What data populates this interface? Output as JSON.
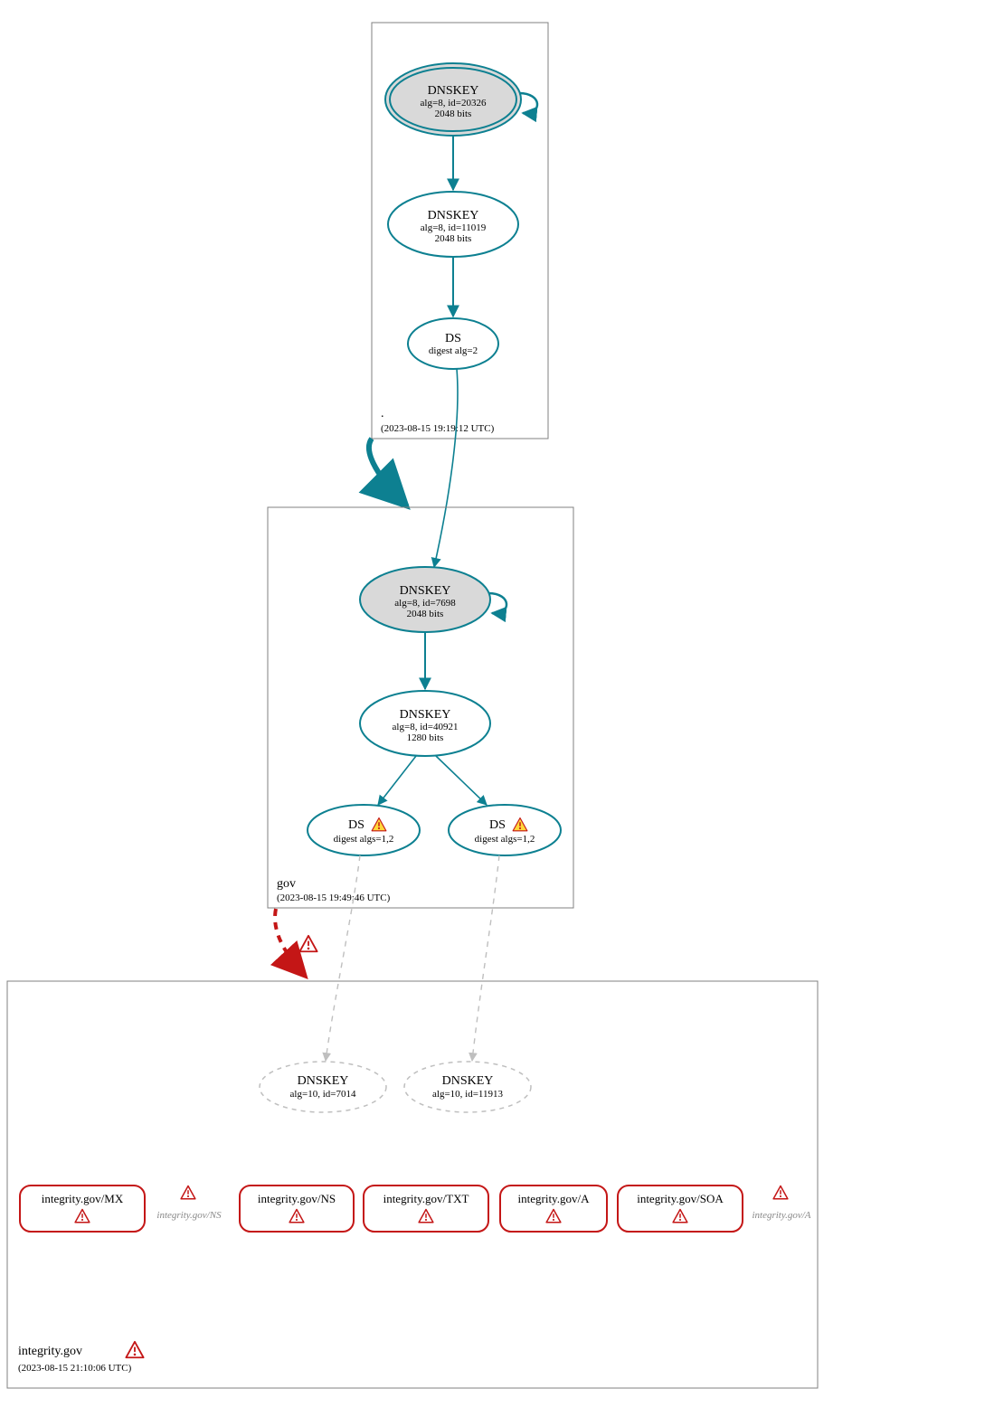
{
  "colors": {
    "teal": "#0d8091",
    "gray_fill": "#d9d9d9",
    "gray_dash": "#bfbfbf",
    "gray_text": "#888888",
    "box_stroke": "#808080",
    "red": "#c41616",
    "warn_fill": "#ffd83a",
    "warn_stroke": "#c41616"
  },
  "zones": {
    "root": {
      "name": ".",
      "timestamp": "(2023-08-15 19:19:12 UTC)",
      "ksk": {
        "title": "DNSKEY",
        "line1": "alg=8, id=20326",
        "line2": "2048 bits"
      },
      "zsk": {
        "title": "DNSKEY",
        "line1": "alg=8, id=11019",
        "line2": "2048 bits"
      },
      "ds": {
        "title": "DS",
        "line1": "digest alg=2"
      }
    },
    "gov": {
      "name": "gov",
      "timestamp": "(2023-08-15 19:49:46 UTC)",
      "ksk": {
        "title": "DNSKEY",
        "line1": "alg=8, id=7698",
        "line2": "2048 bits"
      },
      "zsk": {
        "title": "DNSKEY",
        "line1": "alg=8, id=40921",
        "line2": "1280 bits"
      },
      "ds1": {
        "title": "DS",
        "line1": "digest algs=1,2"
      },
      "ds2": {
        "title": "DS",
        "line1": "digest algs=1,2"
      }
    },
    "integrity": {
      "name": "integrity.gov",
      "timestamp": "(2023-08-15 21:10:06 UTC)",
      "k1": {
        "title": "DNSKEY",
        "line1": "alg=10, id=7014"
      },
      "k2": {
        "title": "DNSKEY",
        "line1": "alg=10, id=11913"
      },
      "rr": [
        {
          "label": "integrity.gov/MX"
        },
        {
          "label": "integrity.gov/NS"
        },
        {
          "label": "integrity.gov/TXT"
        },
        {
          "label": "integrity.gov/A"
        },
        {
          "label": "integrity.gov/SOA"
        }
      ],
      "rr_gray": [
        {
          "label": "integrity.gov/NS"
        },
        {
          "label": "integrity.gov/A"
        }
      ]
    }
  }
}
